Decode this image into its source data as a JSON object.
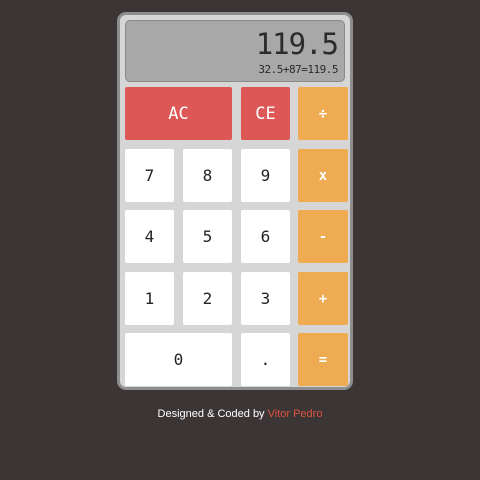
{
  "display": {
    "answer": "119.5",
    "history": "32.5+87=119.5"
  },
  "buttons": {
    "ac": "AC",
    "ce": "CE",
    "divide": "÷",
    "seven": "7",
    "eight": "8",
    "nine": "9",
    "multiply": "x",
    "four": "4",
    "five": "5",
    "six": "6",
    "subtract": "-",
    "one": "1",
    "two": "2",
    "three": "3",
    "add": "+",
    "zero": "0",
    "decimal": ".",
    "equals": "="
  },
  "footer": {
    "text": "Designed & Coded by",
    "author": "Vitor Pedro"
  },
  "colors": {
    "background": "#3b3536",
    "clear_button": "#dd5757",
    "operator_button": "#efab52",
    "author_link": "#e0533f"
  }
}
